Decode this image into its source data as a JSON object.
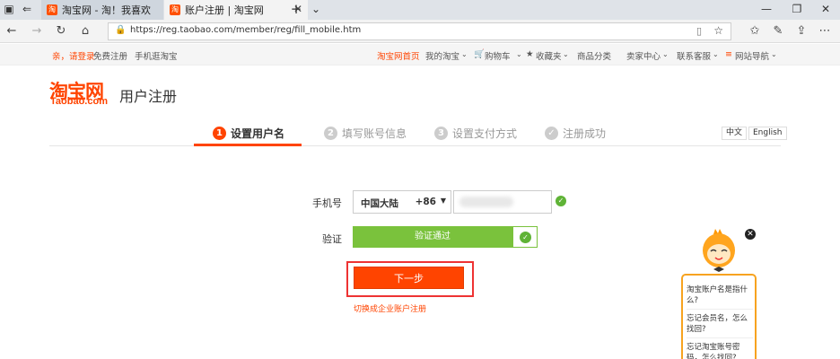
{
  "browser": {
    "tabs": [
      {
        "label": "淘宝网 - 淘！我喜欢",
        "state": "inactive"
      },
      {
        "label": "账户注册 | 淘宝网",
        "state": "active"
      }
    ],
    "new_tab_symbol": "+",
    "url": "https://reg.taobao.com/member/reg/fill_mobile.htm"
  },
  "site_bar": {
    "greeting": "亲，请登录",
    "free_register": "免费注册",
    "mobile_taobao": "手机逛淘宝",
    "home": "淘宝网首页",
    "my_taobao": "我的淘宝",
    "cart": "购物车",
    "favorites": "收藏夹",
    "categories": "商品分类",
    "seller_center": "卖家中心",
    "customer_service": "联系客服",
    "site_nav": "网站导航"
  },
  "header": {
    "logo_cn": "淘宝网",
    "logo_en": "Taobao.com",
    "title": "用户注册"
  },
  "steps": [
    {
      "num": "1",
      "label": "设置用户名",
      "active": true
    },
    {
      "num": "2",
      "label": "填写账号信息",
      "active": false
    },
    {
      "num": "3",
      "label": "设置支付方式",
      "active": false
    },
    {
      "num": "✓",
      "label": "注册成功",
      "active": false
    }
  ],
  "lang": {
    "zh": "中文",
    "en": "English"
  },
  "form": {
    "phone_label": "手机号",
    "country": "中国大陆",
    "country_code": "+86",
    "verify_label": "验证",
    "verify_status": "验证通过",
    "next_button": "下一步",
    "enterprise_link": "切换成企业账户注册"
  },
  "help": {
    "items": [
      "淘宝账户名是指什么?",
      "忘记会员名，怎么找回?",
      "忘记淘宝账号密码，怎么找回?"
    ]
  },
  "colors": {
    "brand_orange": "#ff4400",
    "verify_green": "#7ac23c",
    "highlight_red": "#e33333",
    "help_border": "#f7a320"
  }
}
